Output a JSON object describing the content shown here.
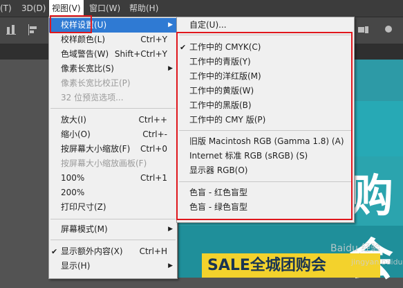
{
  "menubar": {
    "items": [
      "(T)",
      "3D(D)",
      "视图(V)",
      "窗口(W)",
      "帮助(H)"
    ]
  },
  "view_menu": {
    "items": [
      {
        "label": "校样设置(U)",
        "shortcut": "",
        "submenu": true,
        "highlighted": true,
        "disabled": false,
        "checked": false
      },
      {
        "label": "校样颜色(L)",
        "shortcut": "Ctrl+Y",
        "submenu": false,
        "highlighted": false,
        "disabled": false,
        "checked": false
      },
      {
        "label": "色域警告(W)",
        "shortcut": "Shift+Ctrl+Y",
        "submenu": false,
        "highlighted": false,
        "disabled": false,
        "checked": false
      },
      {
        "label": "像素长宽比(S)",
        "shortcut": "",
        "submenu": true,
        "highlighted": false,
        "disabled": false,
        "checked": false
      },
      {
        "label": "像素长宽比校正(P)",
        "shortcut": "",
        "submenu": false,
        "highlighted": false,
        "disabled": true,
        "checked": false
      },
      {
        "label": "32 位预览选项...",
        "shortcut": "",
        "submenu": false,
        "highlighted": false,
        "disabled": true,
        "checked": false
      },
      {
        "label": "放大(I)",
        "shortcut": "Ctrl++",
        "submenu": false,
        "highlighted": false,
        "disabled": false,
        "checked": false
      },
      {
        "label": "缩小(O)",
        "shortcut": "Ctrl+-",
        "submenu": false,
        "highlighted": false,
        "disabled": false,
        "checked": false
      },
      {
        "label": "按屏幕大小缩放(F)",
        "shortcut": "Ctrl+0",
        "submenu": false,
        "highlighted": false,
        "disabled": false,
        "checked": false
      },
      {
        "label": "按屏幕大小缩放画板(F)",
        "shortcut": "",
        "submenu": false,
        "highlighted": false,
        "disabled": true,
        "checked": false
      },
      {
        "label": "100%",
        "shortcut": "Ctrl+1",
        "submenu": false,
        "highlighted": false,
        "disabled": false,
        "checked": false
      },
      {
        "label": "200%",
        "shortcut": "",
        "submenu": false,
        "highlighted": false,
        "disabled": false,
        "checked": false
      },
      {
        "label": "打印尺寸(Z)",
        "shortcut": "",
        "submenu": false,
        "highlighted": false,
        "disabled": false,
        "checked": false
      },
      {
        "label": "屏幕模式(M)",
        "shortcut": "",
        "submenu": true,
        "highlighted": false,
        "disabled": false,
        "checked": false
      },
      {
        "label": "显示额外内容(X)",
        "shortcut": "Ctrl+H",
        "submenu": false,
        "highlighted": false,
        "disabled": false,
        "checked": true
      },
      {
        "label": "显示(H)",
        "shortcut": "",
        "submenu": true,
        "highlighted": false,
        "disabled": false,
        "checked": false
      }
    ]
  },
  "proof_submenu": {
    "items": [
      {
        "label": "自定(U)...",
        "checked": false
      },
      {
        "label": "工作中的 CMYK(C)",
        "checked": true
      },
      {
        "label": "工作中的青版(Y)",
        "checked": false
      },
      {
        "label": "工作中的洋红版(M)",
        "checked": false
      },
      {
        "label": "工作中的黄版(W)",
        "checked": false
      },
      {
        "label": "工作中的黑版(B)",
        "checked": false
      },
      {
        "label": "工作中的 CMY 版(P)",
        "checked": false
      },
      {
        "label": "旧版 Macintosh RGB (Gamma 1.8) (A)",
        "checked": false
      },
      {
        "label": "Internet 标准 RGB (sRGB) (S)",
        "checked": false
      },
      {
        "label": "显示器 RGB(O)",
        "checked": false
      },
      {
        "label": "色盲 - 红色盲型",
        "checked": false
      },
      {
        "label": "色盲 - 绿色盲型",
        "checked": false
      }
    ]
  },
  "canvas": {
    "sale_text": "SALE全城团购会",
    "big_char": "购会",
    "watermark": "Baidu 经验",
    "watermark_url": "jingyan.baidu.com"
  },
  "colors": {
    "highlight": "#2f7ad3",
    "annotation_red": "#e0161c",
    "canvas_teal": "#2aa6b1",
    "banner_yellow": "#f3d22c"
  }
}
